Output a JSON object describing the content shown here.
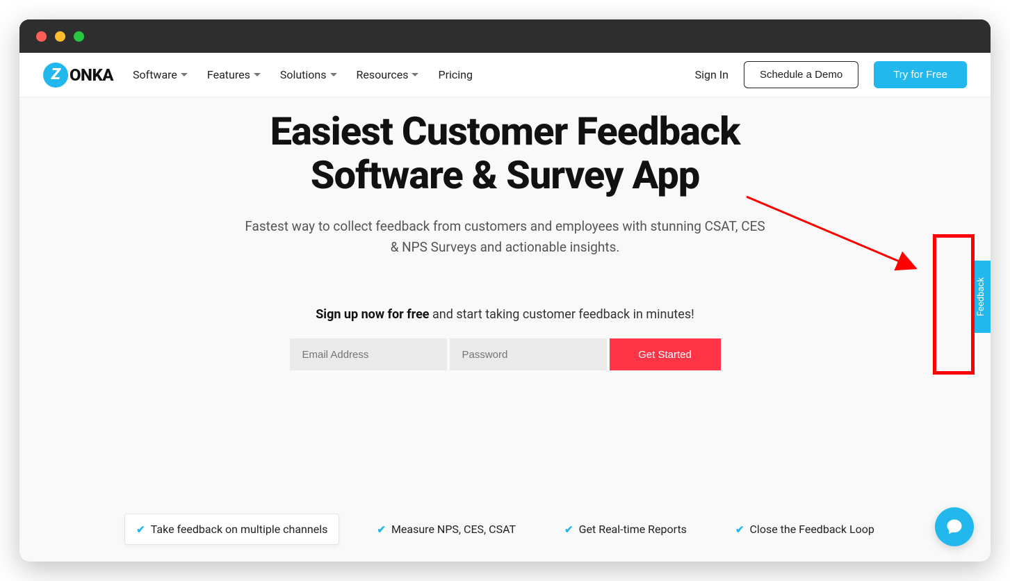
{
  "brand": {
    "logo_letter": "Z",
    "logo_text": "ONKA"
  },
  "nav": {
    "items": [
      {
        "label": "Software",
        "has_dropdown": true
      },
      {
        "label": "Features",
        "has_dropdown": true
      },
      {
        "label": "Solutions",
        "has_dropdown": true
      },
      {
        "label": "Resources",
        "has_dropdown": true
      },
      {
        "label": "Pricing",
        "has_dropdown": false
      }
    ],
    "signin": "Sign In",
    "schedule_demo": "Schedule a Demo",
    "try_free": "Try for Free"
  },
  "hero": {
    "title_line1": "Easiest Customer Feedback",
    "title_line2": "Software & Survey App",
    "subtitle": "Fastest way to collect feedback from customers and employees with stunning CSAT, CES & NPS Surveys and actionable insights."
  },
  "signup": {
    "prompt_bold": "Sign up now for free",
    "prompt_rest": " and start taking customer feedback in minutes!",
    "email_placeholder": "Email Address",
    "password_placeholder": "Password",
    "cta": "Get Started"
  },
  "features": [
    "Take feedback on multiple channels",
    "Measure NPS, CES, CSAT",
    "Get Real-time Reports",
    "Close the Feedback Loop"
  ],
  "side_tab": "Feedback",
  "colors": {
    "accent_cyan": "#22b8ee",
    "cta_red": "#ff3547",
    "annotation_red": "#ff0000"
  }
}
